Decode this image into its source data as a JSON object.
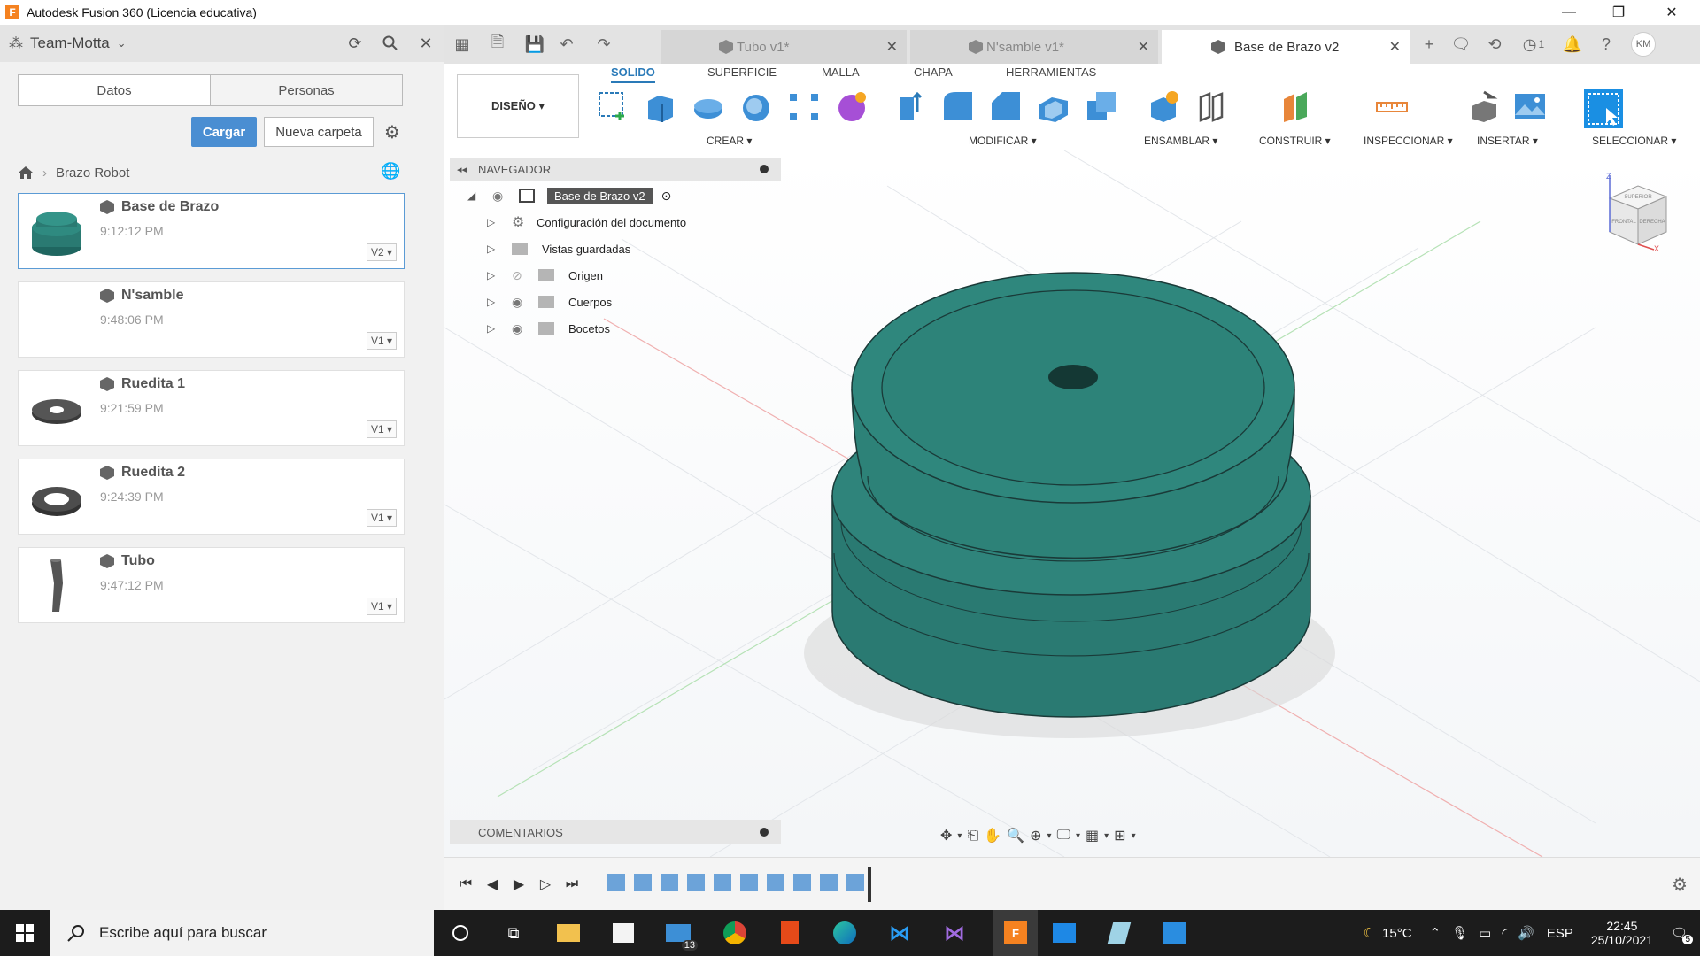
{
  "window": {
    "title": "Autodesk Fusion 360 (Licencia educativa)",
    "logo": "F"
  },
  "data_panel": {
    "team": "Team-Motta",
    "tabs": [
      "Datos",
      "Personas"
    ],
    "upload_label": "Cargar",
    "new_folder_label": "Nueva carpeta",
    "breadcrumb": "Brazo Robot",
    "files": [
      {
        "name": "Base de Brazo",
        "time": "9:12:12 PM",
        "version": "V2 ▾"
      },
      {
        "name": "N'samble",
        "time": "9:48:06 PM",
        "version": "V1 ▾"
      },
      {
        "name": "Ruedita 1",
        "time": "9:21:59 PM",
        "version": "V1 ▾"
      },
      {
        "name": "Ruedita 2",
        "time": "9:24:39 PM",
        "version": "V1 ▾"
      },
      {
        "name": "Tubo",
        "time": "9:47:12 PM",
        "version": "V1 ▾"
      }
    ]
  },
  "doc_tabs": [
    {
      "label": "Tubo v1*"
    },
    {
      "label": "N'samble v1*"
    },
    {
      "label": "Base de Brazo v2"
    }
  ],
  "tabrow": {
    "jobs_count": "1",
    "user_initials": "KM"
  },
  "ribbon": {
    "workspace": "DISEÑO ▾",
    "tabs": [
      "SOLIDO",
      "SUPERFICIE",
      "MALLA",
      "CHAPA",
      "HERRAMIENTAS"
    ],
    "groups": [
      "CREAR ▾",
      "MODIFICAR ▾",
      "ENSAMBLAR ▾",
      "CONSTRUIR ▾",
      "INSPECCIONAR ▾",
      "INSERTAR ▾",
      "SELECCIONAR ▾"
    ]
  },
  "navigator": {
    "title": "NAVEGADOR",
    "root": "Base de Brazo v2",
    "items": [
      "Configuración del documento",
      "Vistas guardadas",
      "Origen",
      "Cuerpos",
      "Bocetos"
    ]
  },
  "viewcube": {
    "top": "SUPERIOR",
    "front": "FRONTAL",
    "right": "DERECHA",
    "z_axis": "Z",
    "x_axis": "X"
  },
  "comments": "COMENTARIOS",
  "taskbar": {
    "search_placeholder": "Escribe aquí para buscar",
    "mail_badge": "13",
    "temperature": "15°C",
    "language": "ESP",
    "time": "22:45",
    "date": "25/10/2021",
    "notifications": "5"
  },
  "colors": {
    "accent": "#2a7ab8",
    "model": "#2a7a72",
    "button": "#4a8ed2"
  }
}
